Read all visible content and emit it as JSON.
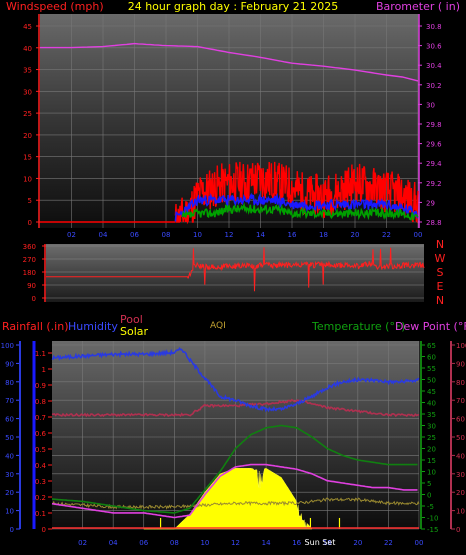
{
  "header": {
    "windspeed_label": "Windspeed (mph)",
    "graph_title": "24 hour graph day : February 21 2025",
    "barometer_label": "Barometer ( in)"
  },
  "colors": {
    "background": "#000000",
    "wind": "#ff0000",
    "wind_blue": "#1a1aff",
    "wind_green": "#00a000",
    "barometer": "#e040e0",
    "title": "#ffff00",
    "direction": "#ff2020",
    "humidity": "#2a3adf",
    "rain": "#1a1aff",
    "pool": "#b03050",
    "solar": "#ffff00",
    "temperature": "#108010",
    "dew_point": "#e040e0",
    "aqi": "#c0a030"
  },
  "wind_panel": {
    "left_ticks": [
      "45",
      "40",
      "35",
      "30",
      "25",
      "20",
      "15",
      "10",
      "5",
      "0"
    ],
    "right_ticks": [
      "30.8",
      "30.6",
      "30.4",
      "30.2",
      "30",
      "29.8",
      "29.6",
      "29.4",
      "29.2",
      "29",
      "28.8"
    ],
    "x_ticks": [
      "02",
      "04",
      "06",
      "08",
      "10",
      "12",
      "14",
      "16",
      "18",
      "20",
      "22",
      "00"
    ]
  },
  "direction_panel": {
    "left_ticks": [
      "360",
      "270",
      "180",
      "90",
      "0"
    ],
    "right_labels": [
      "N",
      "W",
      "S",
      "E",
      "N"
    ]
  },
  "bottom_panel": {
    "rainfall_label": "Rainfall (.in)",
    "humidity_label": "Humidity",
    "pool_label": "Pool",
    "solar_label": "Solar",
    "aqi_label": "AQI",
    "temperature_label": "Temperature (°F)",
    "dew_point_label": "Dew Point (°F)",
    "humidity_ticks": [
      "100",
      "90",
      "80",
      "70",
      "60",
      "50",
      "40",
      "30",
      "20",
      "10",
      "0"
    ],
    "rain_ticks": [
      "1.1",
      "1",
      "0.9",
      "0.8",
      "0.7",
      "0.6",
      "0.5",
      "0.4",
      "0.3",
      "0.2",
      "0.1",
      "0"
    ],
    "temp_ticks": [
      "65",
      "60",
      "55",
      "50",
      "45",
      "40",
      "35",
      "30",
      "25",
      "20",
      "15",
      "10",
      "5",
      "0",
      "-5",
      "-10",
      "-15"
    ],
    "pool_ticks": [
      "100",
      "90",
      "80",
      "70",
      "60",
      "50",
      "40",
      "30",
      "20",
      "10",
      "0"
    ],
    "x_ticks": [
      "02",
      "04",
      "06",
      "08",
      "10",
      "12",
      "14",
      "16",
      "18",
      "20",
      "22",
      "00"
    ],
    "sun_set_label": "Sun Set"
  },
  "chart_data": [
    {
      "type": "line",
      "x_unit": "hour",
      "xlim": [
        0,
        24
      ],
      "ylabel": "Windspeed (mph)",
      "ylim": [
        0,
        45
      ],
      "y2label": "Barometer ( in)",
      "y2lim": [
        28.8,
        30.8
      ],
      "series": [
        {
          "axis": "y2",
          "x": [
            0,
            2,
            4,
            6,
            8,
            10,
            12,
            14,
            16,
            18,
            20,
            22,
            23,
            24
          ],
          "values": [
            30.58,
            30.58,
            30.59,
            30.62,
            30.6,
            30.59,
            30.53,
            30.48,
            30.42,
            30.39,
            30.35,
            30.3,
            30.28,
            30.24
          ]
        },
        {
          "axis": "y",
          "x": [
            0,
            8.6,
            9.4,
            10,
            11,
            12,
            13,
            14,
            15,
            16,
            17,
            18,
            19,
            20,
            21,
            22,
            23,
            24
          ],
          "values": [
            0,
            0,
            2,
            6,
            8,
            9,
            9,
            10,
            9,
            8,
            6,
            6,
            7,
            9,
            8,
            7,
            6,
            4
          ]
        },
        {
          "axis": "y",
          "x": [
            8.6,
            9.4,
            10,
            11,
            12,
            13,
            14,
            15,
            16,
            17,
            18,
            19,
            20,
            21,
            22,
            23,
            24
          ],
          "values": [
            1,
            3,
            5,
            5,
            5,
            5,
            5,
            5,
            4,
            4,
            4,
            4,
            4,
            4,
            4,
            3,
            2
          ]
        },
        {
          "axis": "y",
          "x": [
            9,
            10,
            11,
            12,
            13,
            14,
            15,
            16,
            17,
            18,
            19,
            20,
            21,
            22,
            23,
            24
          ],
          "values": [
            1,
            2,
            2,
            3,
            3,
            3,
            3,
            2,
            2,
            2,
            2,
            2,
            2,
            2,
            2,
            1
          ]
        }
      ]
    },
    {
      "type": "line",
      "x_unit": "hour",
      "xlim": [
        0,
        24
      ],
      "ylim": [
        0,
        360
      ],
      "series": [
        {
          "x": [
            0,
            9,
            9.5,
            10,
            12,
            14,
            16,
            18,
            20,
            20.5,
            21,
            22,
            23,
            24
          ],
          "values": [
            147,
            147,
            230,
            215,
            220,
            225,
            228,
            230,
            222,
            240,
            215,
            220,
            228,
            225
          ]
        }
      ]
    },
    {
      "type": "line",
      "x_unit": "hour",
      "xlim": [
        0,
        24
      ],
      "ylim": [
        0,
        100
      ],
      "y2lim": [
        -15,
        65
      ],
      "series": [
        {
          "name": "Humidity",
          "axis": "y",
          "x": [
            0,
            2,
            4,
            6,
            8,
            8.5,
            9,
            10,
            11,
            12,
            13,
            14,
            15,
            16,
            17,
            18,
            19,
            20,
            21,
            22,
            23,
            24
          ],
          "values": [
            93,
            94,
            95,
            95,
            96,
            98,
            92,
            82,
            72,
            70,
            67,
            65,
            65,
            68,
            72,
            77,
            80,
            81,
            81,
            80,
            80,
            81
          ]
        },
        {
          "name": "Pool",
          "axis": "y",
          "x": [
            0,
            4,
            8,
            9,
            10,
            12,
            14,
            16,
            18,
            20,
            22,
            24
          ],
          "values": [
            62,
            62,
            62,
            62,
            67,
            67,
            68,
            70,
            66,
            64,
            62,
            62
          ]
        },
        {
          "name": "Temperature",
          "axis": "y2",
          "x": [
            0,
            2,
            4,
            6,
            8,
            9,
            10,
            11,
            12,
            13,
            14,
            15,
            16,
            17,
            18,
            19,
            20,
            21,
            22,
            23,
            24
          ],
          "values": [
            -2,
            -3,
            -5,
            -7,
            -8,
            -6,
            2,
            10,
            20,
            26,
            29,
            30,
            29,
            25,
            20,
            17,
            15,
            14,
            13,
            13,
            13
          ]
        },
        {
          "name": "Dew Point",
          "axis": "y2",
          "x": [
            0,
            2,
            4,
            6,
            8,
            9,
            10,
            11,
            12,
            13,
            14,
            15,
            16,
            17,
            18,
            19,
            20,
            21,
            22,
            23,
            24
          ],
          "values": [
            -4,
            -6,
            -8,
            -8,
            -10,
            -9,
            0,
            8,
            12,
            13,
            13,
            12,
            11,
            9,
            6,
            5,
            4,
            3,
            3,
            2,
            2
          ]
        },
        {
          "name": "Solar",
          "axis": "y",
          "x": [
            6,
            8,
            9,
            10,
            11,
            12,
            13,
            13.5,
            14,
            15,
            16,
            16.7,
            17
          ],
          "values": [
            0,
            0,
            8,
            20,
            30,
            33,
            33,
            32,
            33,
            28,
            15,
            3,
            0
          ]
        },
        {
          "name": "AQI",
          "axis": "y",
          "x": [
            0,
            4,
            8,
            10,
            12,
            14,
            16,
            18,
            20,
            22,
            24
          ],
          "values": [
            14,
            12,
            12,
            13,
            14,
            14,
            14,
            16,
            16,
            14,
            14
          ]
        },
        {
          "name": "Rainfall",
          "axis": "y",
          "x": [
            0,
            24
          ],
          "values": [
            0,
            0
          ]
        }
      ]
    }
  ]
}
